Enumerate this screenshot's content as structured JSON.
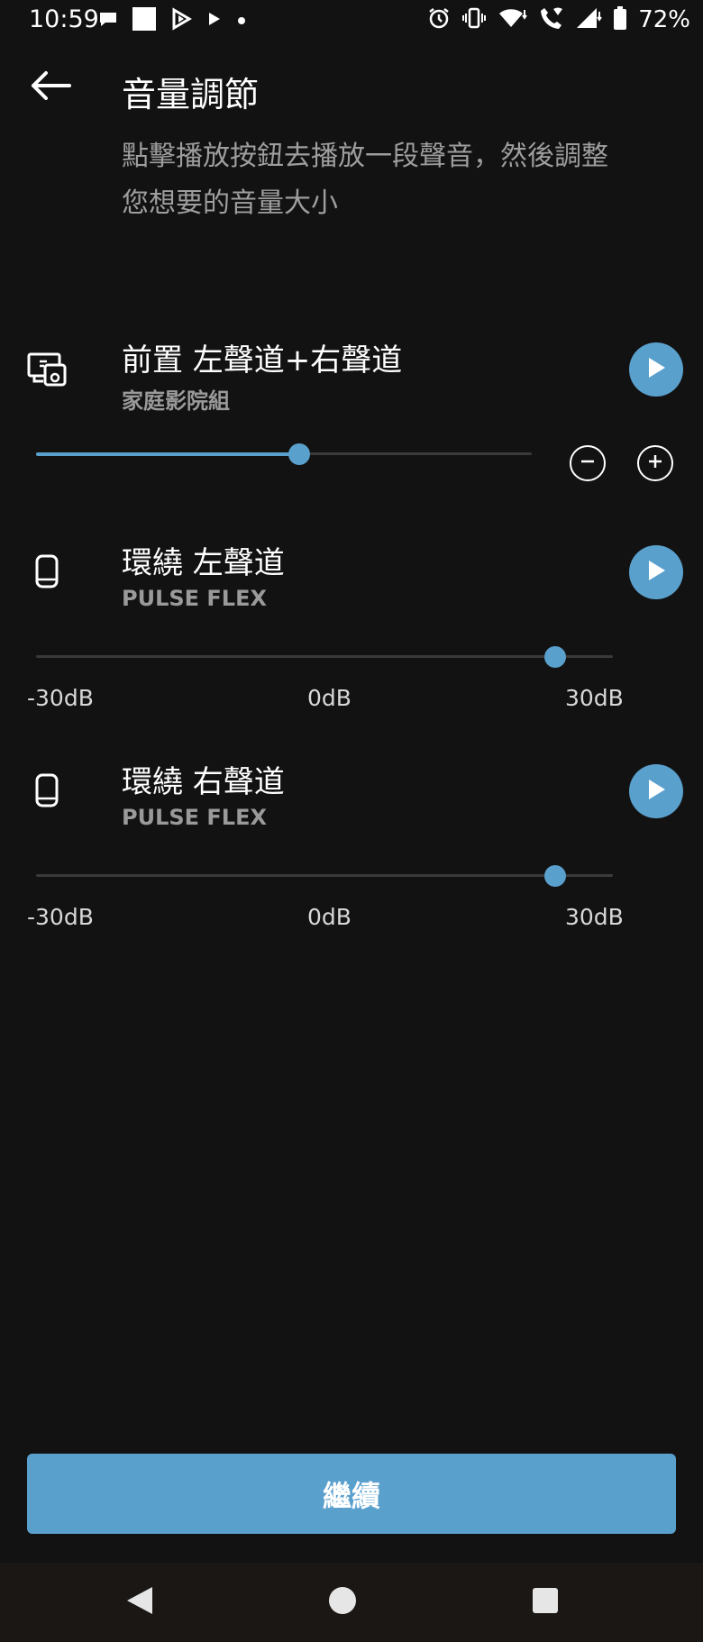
{
  "status_bar": {
    "time": "10:59",
    "battery": "72%",
    "icons_left": [
      "chat-bubble-icon",
      "square-icon",
      "play-store-icon",
      "play-icon",
      "dot-icon"
    ],
    "icons_right": [
      "alarm-icon",
      "vibrate-icon",
      "wifi-icon",
      "wifi-call-icon",
      "signal-icon",
      "battery-icon"
    ]
  },
  "header": {
    "title": "音量調節",
    "description": "點擊播放按鈕去播放一段聲音，然後調整您想要的音量大小"
  },
  "channels": [
    {
      "title": "前置 左聲道+右聲道",
      "subtitle": "家庭影院組",
      "icon": "home-theater-icon",
      "volume_fraction": 0.53,
      "has_stepper": true
    },
    {
      "title": "環繞 左聲道",
      "subtitle": "PULSE FLEX",
      "icon": "speaker-icon",
      "volume_fraction": 0.9,
      "scale_labels": [
        "-30dB",
        "0dB",
        "30dB"
      ]
    },
    {
      "title": "環繞 右聲道",
      "subtitle": "PULSE FLEX",
      "icon": "speaker-icon",
      "volume_fraction": 0.9,
      "scale_labels": [
        "-30dB",
        "0dB",
        "30dB"
      ]
    }
  ],
  "continue_label": "繼續",
  "colors": {
    "accent": "#5aa0cd",
    "background": "#121212",
    "secondary_text": "#9e9e9e"
  }
}
